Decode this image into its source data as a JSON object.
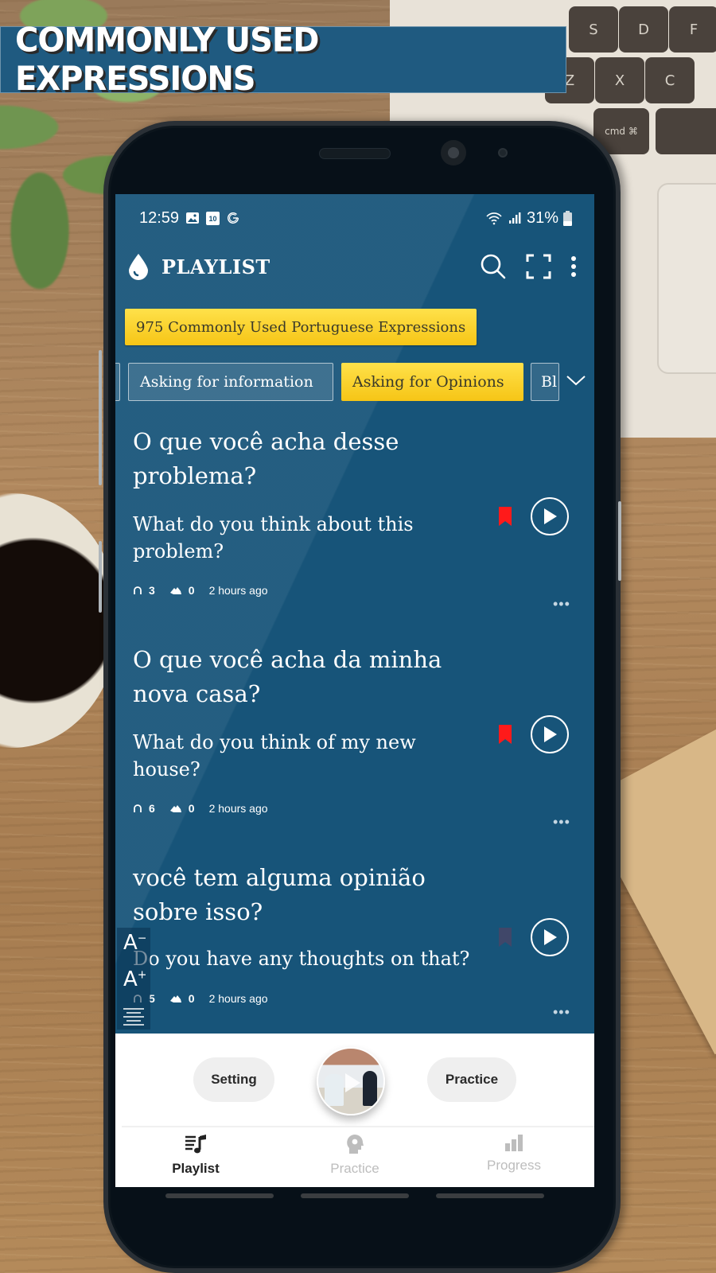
{
  "banner": {
    "title": "COMMONLY USED EXPRESSIONS"
  },
  "background": {
    "keys": [
      "S",
      "D",
      "F",
      "Z",
      "X",
      "C",
      "cmd ⌘"
    ]
  },
  "status_bar": {
    "time": "12:59",
    "calendar_day": "10",
    "left_icons": [
      "gallery-icon",
      "calendar-icon",
      "google-icon"
    ],
    "right_icons": [
      "wifi-icon",
      "signal-icon",
      "battery-icon"
    ],
    "battery": "31%"
  },
  "app_bar": {
    "title": "PLAYLIST",
    "logo_icon": "droplet-icon",
    "actions": [
      "search-icon",
      "fullscreen-icon",
      "more-vertical-icon"
    ]
  },
  "playlist": {
    "name": "975 Commonly Used Portuguese Expressions"
  },
  "category_tabs": {
    "tabs": [
      {
        "label": "",
        "state": "partial"
      },
      {
        "label": "Asking for information",
        "state": "inactive"
      },
      {
        "label": "Asking for Opinions",
        "state": "active"
      },
      {
        "label": "Bl",
        "state": "partial"
      }
    ],
    "expand_icon": "chevron-down-icon"
  },
  "items": [
    {
      "phrase": "O que você acha desse problema?",
      "translation": "What do you think about this problem?",
      "listens": "3",
      "practices": "0",
      "time": "2 hours ago",
      "bookmarked": true
    },
    {
      "phrase": "O que você acha da minha nova casa?",
      "translation": "What do you think of my new house?",
      "listens": "6",
      "practices": "0",
      "time": "2 hours ago",
      "bookmarked": true
    },
    {
      "phrase": "você tem alguma opinião sobre isso?",
      "translation": "Do you have any thoughts on that?",
      "listens": "5",
      "practices": "0",
      "time": "2 hours ago",
      "bookmarked": false
    }
  ],
  "font_controls": {
    "decrease": "A",
    "increase": "A",
    "decrease_sup": "−",
    "increase_sup": "+"
  },
  "bottom_actions": {
    "setting": "Setting",
    "practice": "Practice"
  },
  "bottom_nav": [
    {
      "label": "Playlist",
      "icon": "playlist-music-icon",
      "active": true
    },
    {
      "label": "Practice",
      "icon": "head-gear-icon",
      "active": false
    },
    {
      "label": "Progress",
      "icon": "bar-chart-icon",
      "active": false
    }
  ],
  "colors": {
    "app_bg": "#175479",
    "accent_yellow": "#f6c516",
    "bookmark_red": "#ff1a1a",
    "banner_bg": "#1f5a80"
  }
}
